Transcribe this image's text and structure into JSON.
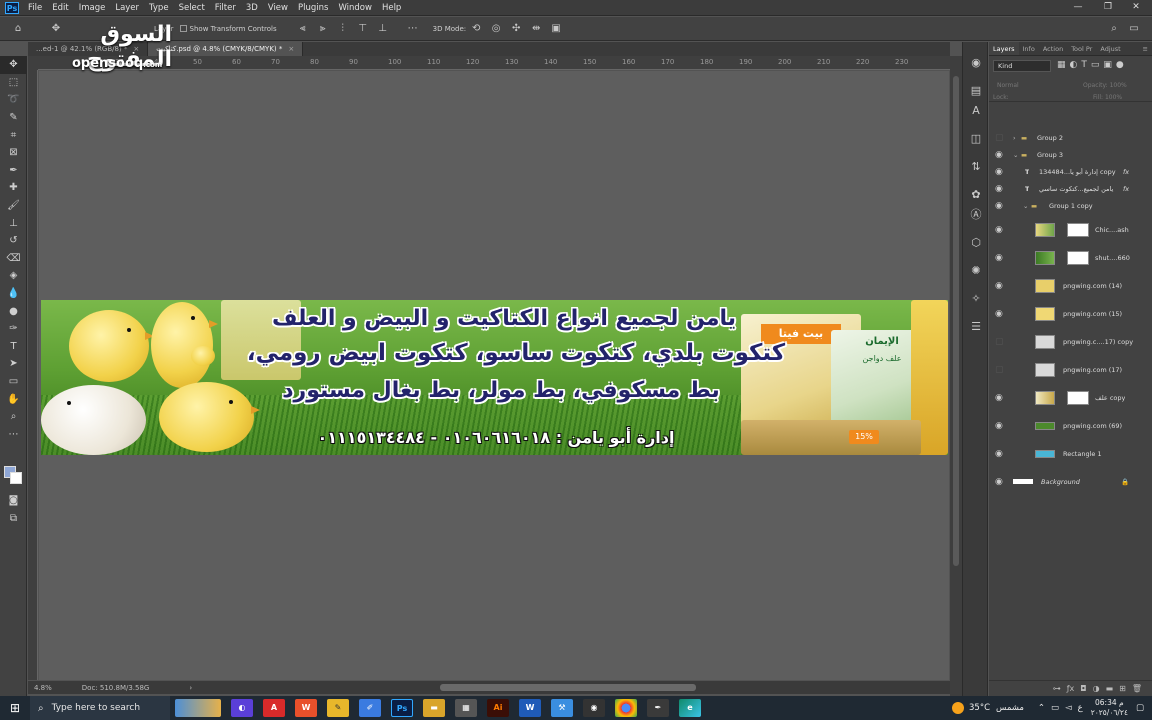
{
  "menu": {
    "logo": "Ps",
    "items": [
      "File",
      "Edit",
      "Image",
      "Layer",
      "Type",
      "Select",
      "Filter",
      "3D",
      "View",
      "Plugins",
      "Window",
      "Help"
    ],
    "min": "—",
    "max": "❐",
    "close": "✕"
  },
  "options": {
    "show_transform_controls": "Show Transform Controls",
    "three_d_mode": "3D Mode:",
    "auto_select": "Layer"
  },
  "tabs": [
    {
      "label": "...ed-1 @ 42.1% (RGB/8) *",
      "close": "×"
    },
    {
      "label": "كتاكيت.psd @ 4.8% (CMYK/8/CMYK) *",
      "close": "×"
    }
  ],
  "ruler": {
    "ticks": [
      "20",
      "30",
      "40",
      "50",
      "60",
      "70",
      "80",
      "90",
      "100",
      "110",
      "120",
      "130",
      "140",
      "150",
      "160",
      "170",
      "180",
      "190",
      "200",
      "210",
      "220",
      "230"
    ],
    "v_ticks": [
      "0",
      "5",
      "1",
      "0",
      "1",
      "5",
      "2",
      "0",
      "2",
      "5",
      "3",
      "0",
      "3",
      "5",
      "4",
      "0",
      "4",
      "5",
      "5",
      "0",
      "5",
      "5",
      "6",
      "0"
    ]
  },
  "banner": {
    "line1": "يامن لجميع انواع الكتاكيت و البيض و العلف",
    "line2": "كتكوت بلدي، كتكوت ساسو، كتكوت ابيض رومي،",
    "line3": "بط مسكوفي، بط مولر، بط بغال مستورد",
    "phone": "إدارة أبو يامن : ٠١٠٦٠٦١٦٠١٨ - ٠١١١٥١٣٤٤٨٤",
    "bag1_label": "بيت فيتا",
    "bag2_label": "الإيمان",
    "bag3_label": "علف دواجن",
    "bag_price": "15%"
  },
  "status": {
    "zoom": "4.8%",
    "doc": "Doc: 510.8M/3.58G",
    "arrow": "›"
  },
  "panel": {
    "tabs": [
      "Layers",
      "Info",
      "Action",
      "Tool Pr",
      "Adjust"
    ],
    "menu_icon": "≡",
    "kind": "Kind",
    "blend": "Normal",
    "opacity": "Opacity: 100%",
    "lock": "Lock:",
    "fill": "Fill: 100%",
    "layers": [
      {
        "name": "Group 2"
      },
      {
        "name": "Group 3"
      },
      {
        "name": "إدارة أبو يا...134484 copy"
      },
      {
        "name": "يامن لجميع...كتكوت ساسي"
      },
      {
        "name": "Group 1 copy"
      },
      {
        "name": "Chic....ash"
      },
      {
        "name": "shut....660"
      },
      {
        "name": "pngwing.com (14)"
      },
      {
        "name": "pngwing.com (15)"
      },
      {
        "name": "pngwing.c....17) copy"
      },
      {
        "name": "pngwing.com (17)"
      },
      {
        "name": "علف copy"
      },
      {
        "name": "pngwing.com (69)"
      },
      {
        "name": "Rectangle 1"
      },
      {
        "name": "Background"
      }
    ],
    "fx": "fx"
  },
  "watermark": {
    "arabic": "السوق المفتوح",
    "latin": "opensooq",
    "suffix": ".com"
  },
  "taskbar": {
    "search": "Type here to search",
    "temp": "35°C",
    "weather": "مشمس",
    "lang": "ع",
    "time": "06:34 م",
    "date": "٢٠٢٥/٠٦/٢٤"
  },
  "colors": {
    "accent": "#31a8ff",
    "banner_text": "#23236b",
    "fg_swatch": "#8fa7d6",
    "bg_swatch": "#ffffff"
  }
}
